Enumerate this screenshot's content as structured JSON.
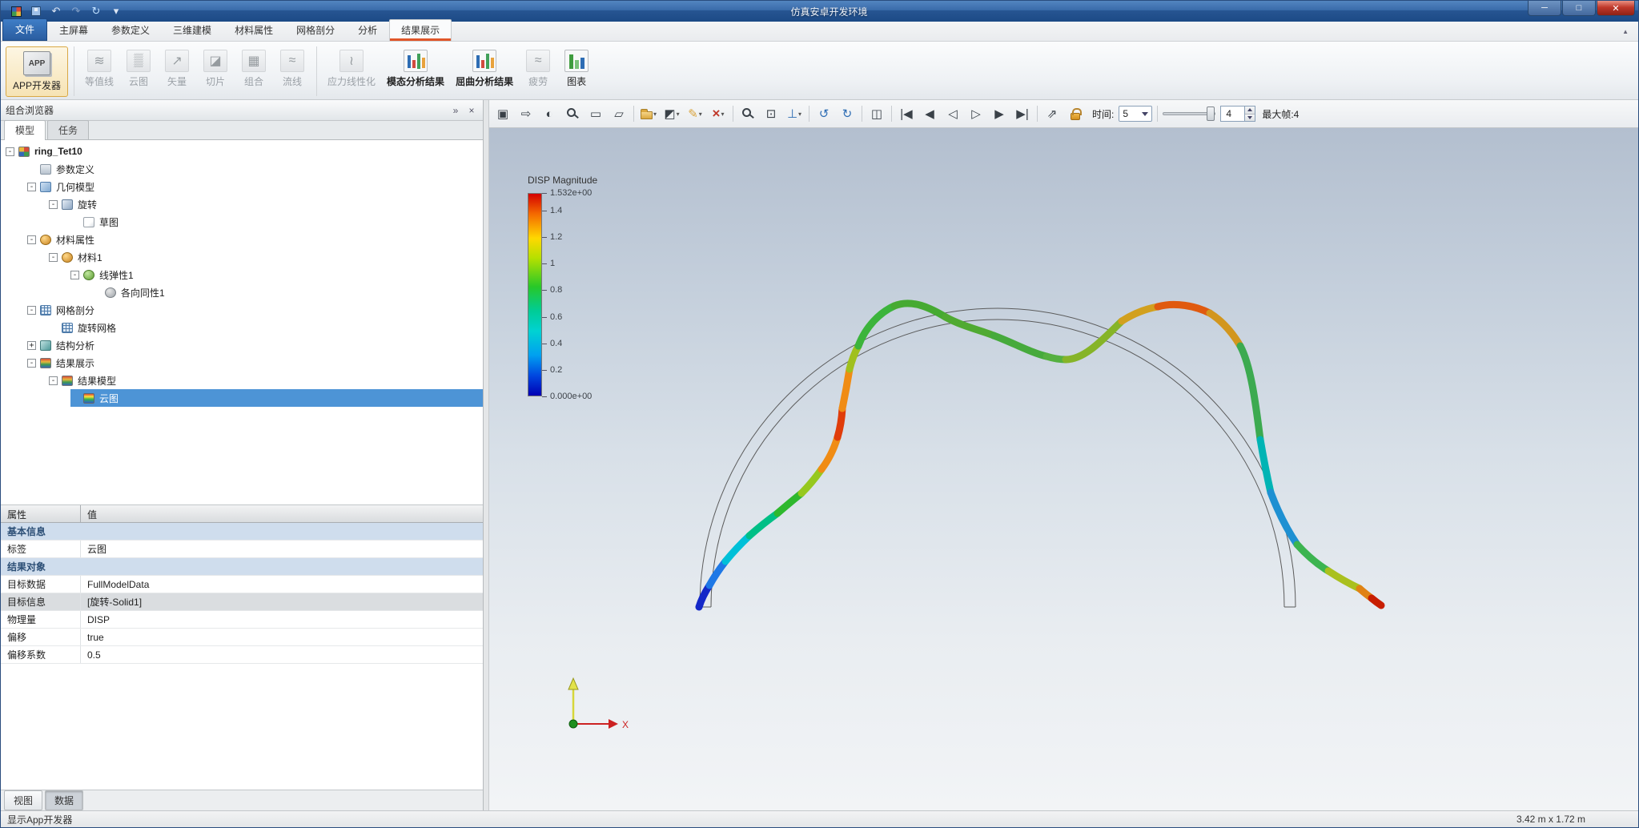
{
  "colors": {
    "titlebar": "#2c5f9e",
    "close_button": "#c0392b",
    "tab_accent": "#e0562a",
    "tree_selection": "#4d94d6",
    "section_row": "#cfdded",
    "viewport_top": "#b3bfcf",
    "viewport_bottom": "#f2f4f6"
  },
  "window": {
    "title": "仿真安卓开发环境",
    "quick_access": [
      {
        "name": "app-logo-icon",
        "kind": "logo"
      },
      {
        "name": "save-icon",
        "kind": "disk"
      },
      {
        "name": "undo-icon",
        "glyph": "↶"
      },
      {
        "name": "redo-icon",
        "glyph": "↷",
        "state": "disabled"
      },
      {
        "name": "refresh-icon",
        "glyph": "↻",
        "color": "refresh"
      },
      {
        "name": "qat-menu-icon",
        "glyph": "▾"
      }
    ],
    "controls": [
      {
        "name": "minimize-button",
        "glyph": "─"
      },
      {
        "name": "maximize-button",
        "glyph": "□"
      },
      {
        "name": "close-button",
        "glyph": "✕",
        "kind": "close"
      }
    ]
  },
  "ribbon": {
    "collapse_glyph": "▲",
    "tabs": [
      {
        "name": "tab-file",
        "label": "文件",
        "kind": "file"
      },
      {
        "name": "tab-home",
        "label": "主屏幕"
      },
      {
        "name": "tab-parameter-definition",
        "label": "参数定义"
      },
      {
        "name": "tab-3d-modeling",
        "label": "三维建模"
      },
      {
        "name": "tab-material-properties",
        "label": "材料属性"
      },
      {
        "name": "tab-meshing",
        "label": "网格剖分"
      },
      {
        "name": "tab-analysis",
        "label": "分析"
      },
      {
        "name": "tab-result-display",
        "label": "结果展示",
        "state": "active"
      }
    ],
    "app_dev": {
      "label": "APP开发器",
      "icon_text": "APP"
    },
    "plot_buttons": [
      {
        "name": "isoline-button",
        "label": "等值线",
        "icon": "isoline-icon",
        "glyph": "≋",
        "state": "disabled"
      },
      {
        "name": "contour-button",
        "label": "云图",
        "icon": "contour-icon",
        "glyph": "▒",
        "state": "disabled"
      },
      {
        "name": "vector-button",
        "label": "矢量",
        "icon": "vector-icon",
        "glyph": "↗",
        "state": "disabled"
      },
      {
        "name": "slice-button",
        "label": "切片",
        "icon": "slice-icon",
        "glyph": "◪",
        "state": "disabled"
      },
      {
        "name": "combine-button",
        "label": "组合",
        "icon": "combine-icon",
        "glyph": "▦",
        "state": "disabled"
      },
      {
        "name": "streamline-button",
        "label": "流线",
        "icon": "streamline-icon",
        "glyph": "≈",
        "state": "disabled"
      }
    ],
    "result_buttons": [
      {
        "name": "stress-linearization-button",
        "label": "应力线性化",
        "icon": "stress-linearization-icon",
        "glyph": "≀",
        "state": "disabled"
      },
      {
        "name": "modal-results-button",
        "label": "模态分析结果",
        "icon": "modal-results-icon",
        "kind": "bars",
        "state": "emphasis"
      },
      {
        "name": "buckling-results-button",
        "label": "屈曲分析结果",
        "icon": "buckling-results-icon",
        "kind": "bars",
        "state": "emphasis"
      },
      {
        "name": "fatigue-button",
        "label": "疲劳",
        "icon": "fatigue-icon",
        "glyph": "≈",
        "state": "disabled"
      },
      {
        "name": "chart-button",
        "label": "图表",
        "icon": "chart-icon",
        "kind": "chart"
      }
    ]
  },
  "browser_panel": {
    "title": "组合浏览器",
    "pin_glyph": "»",
    "close_glyph": "×",
    "tabs": [
      {
        "name": "model-tab",
        "label": "模型",
        "state": "active"
      },
      {
        "name": "task-tab",
        "label": "任务"
      }
    ],
    "tree": [
      {
        "name": "tree-item-ring-tet10",
        "label": "ring_Tet10",
        "level": 0,
        "exp": "-",
        "icon": "model-icon"
      },
      {
        "name": "tree-item-parameter-definition",
        "label": "参数定义",
        "level": 1,
        "icon": "parameter-icon"
      },
      {
        "name": "tree-item-geometry-model",
        "label": "几何模型",
        "level": 1,
        "exp": "-",
        "icon": "geometry-icon"
      },
      {
        "name": "tree-item-revolve",
        "label": "旋转",
        "level": 2,
        "exp": "-",
        "icon": "revolve-icon"
      },
      {
        "name": "tree-item-sketch",
        "label": "草图",
        "level": 3,
        "icon": "sketch-icon"
      },
      {
        "name": "tree-item-material-properties",
        "label": "材料属性",
        "level": 1,
        "exp": "-",
        "icon": "material-icon"
      },
      {
        "name": "tree-item-material1",
        "label": "材料1",
        "level": 2,
        "exp": "-",
        "icon": "material1-icon"
      },
      {
        "name": "tree-item-linear-elastic1",
        "label": "线弹性1",
        "level": 3,
        "exp": "-",
        "icon": "elastic-icon"
      },
      {
        "name": "tree-item-isotropic1",
        "label": "各向同性1",
        "level": 4,
        "icon": "isotropic-icon"
      },
      {
        "name": "tree-item-meshing",
        "label": "网格剖分",
        "level": 1,
        "exp": "-",
        "icon": "mesh-icon"
      },
      {
        "name": "tree-item-revolve-mesh",
        "label": "旋转网格",
        "level": 2,
        "icon": "revolve-mesh-icon"
      },
      {
        "name": "tree-item-structural-analysis",
        "label": "结构分析",
        "level": 1,
        "exp": "+",
        "icon": "analysis-icon"
      },
      {
        "name": "tree-item-result-display",
        "label": "结果展示",
        "level": 1,
        "exp": "-",
        "icon": "results-icon"
      },
      {
        "name": "tree-item-result-model",
        "label": "结果模型",
        "level": 2,
        "exp": "-",
        "icon": "result-model-icon"
      },
      {
        "name": "tree-item-cloud-plot",
        "label": "云图",
        "level": 3,
        "icon": "cloud-plot-tree-icon",
        "state": "selected"
      }
    ]
  },
  "properties_panel": {
    "headers": [
      "属性",
      "值"
    ],
    "rows": [
      {
        "type": "section",
        "label": "基本信息"
      },
      {
        "type": "kv",
        "label": "标签",
        "value": "云图"
      },
      {
        "type": "section",
        "label": "结果对象"
      },
      {
        "type": "kv",
        "label": "目标数据",
        "value": "FullModelData"
      },
      {
        "type": "kv",
        "label": "目标信息",
        "value": "[旋转-Solid1]",
        "state": "highlight"
      },
      {
        "type": "kv",
        "label": "物理量",
        "value": "DISP"
      },
      {
        "type": "kv",
        "label": "偏移",
        "value": "true"
      },
      {
        "type": "kv",
        "label": "偏移系数",
        "value": "0.5"
      }
    ],
    "bottom_tabs": [
      {
        "name": "view-tab",
        "label": "视图"
      },
      {
        "name": "data-tab",
        "label": "数据",
        "state": "active"
      }
    ]
  },
  "viewport": {
    "toolbar": {
      "items": [
        {
          "name": "probe-select-icon",
          "glyph": "▣"
        },
        {
          "name": "capture-view-icon",
          "glyph": "⇨"
        },
        {
          "name": "orbit-view-icon",
          "glyph": "◐"
        },
        {
          "name": "zoom-select-icon",
          "kind": "magnifier"
        },
        {
          "name": "rect-select-icon",
          "glyph": "▭"
        },
        {
          "name": "polygon-select-icon",
          "glyph": "▱"
        },
        {
          "name": "toolbar-separator",
          "kind": "sep"
        },
        {
          "name": "create-group-icon",
          "kind": "folder",
          "dd": "▾"
        },
        {
          "name": "select-mode-icon",
          "glyph": "◩",
          "dd": "▾"
        },
        {
          "name": "clear-marks-icon",
          "glyph": "✎",
          "color": "gold",
          "dd": "▾"
        },
        {
          "name": "delete-icon",
          "glyph": "×",
          "color": "red",
          "dd": "▾"
        },
        {
          "name": "toolbar-separator",
          "kind": "sep"
        },
        {
          "name": "zoom-window-icon",
          "kind": "magnifier"
        },
        {
          "name": "fit-view-icon",
          "glyph": "⊡"
        },
        {
          "name": "axes-view-icon",
          "glyph": "⊥",
          "color": "blue",
          "dd": "▾"
        },
        {
          "name": "toolbar-separator",
          "kind": "sep"
        },
        {
          "name": "rotate-ccw-icon",
          "glyph": "↺",
          "color": "blue"
        },
        {
          "name": "rotate-cw-icon",
          "glyph": "↻",
          "color": "blue"
        },
        {
          "name": "toolbar-separator",
          "kind": "sep"
        },
        {
          "name": "snapshot-view-icon",
          "glyph": "◫"
        },
        {
          "name": "toolbar-separator",
          "kind": "sep"
        },
        {
          "name": "first-frame-icon",
          "glyph": "|◀"
        },
        {
          "name": "prev-frame-icon",
          "glyph": "◀"
        },
        {
          "name": "play-backward-icon",
          "glyph": "◁"
        },
        {
          "name": "play-forward-icon",
          "glyph": "▷"
        },
        {
          "name": "next-frame-icon",
          "glyph": "▶"
        },
        {
          "name": "last-frame-icon",
          "glyph": "▶|"
        },
        {
          "name": "toolbar-separator",
          "kind": "sep"
        },
        {
          "name": "export-animation-icon",
          "glyph": "⇗"
        },
        {
          "name": "lock-icon",
          "kind": "lock"
        }
      ],
      "time_label": "时间:",
      "time_value": "5",
      "frame_value": "4",
      "max_frame_label": "最大帧:4"
    },
    "legend": {
      "title": "DISP Magnitude",
      "max": "1.532e+00",
      "ticks": [
        "1.4",
        "1.2",
        "1",
        "0.8",
        "0.6",
        "0.4",
        "0.2"
      ],
      "min": "0.000e+00",
      "colors": [
        "#d40000",
        "#f46a00",
        "#ffd800",
        "#b4e000",
        "#28c828",
        "#00cc96",
        "#00d2d2",
        "#00a0f0",
        "#0048e0",
        "#0000b4"
      ]
    },
    "triad": {
      "x_label": "X"
    }
  },
  "status_bar": {
    "left": "显示App开发器",
    "right": "3.42 m x 1.72 m"
  }
}
